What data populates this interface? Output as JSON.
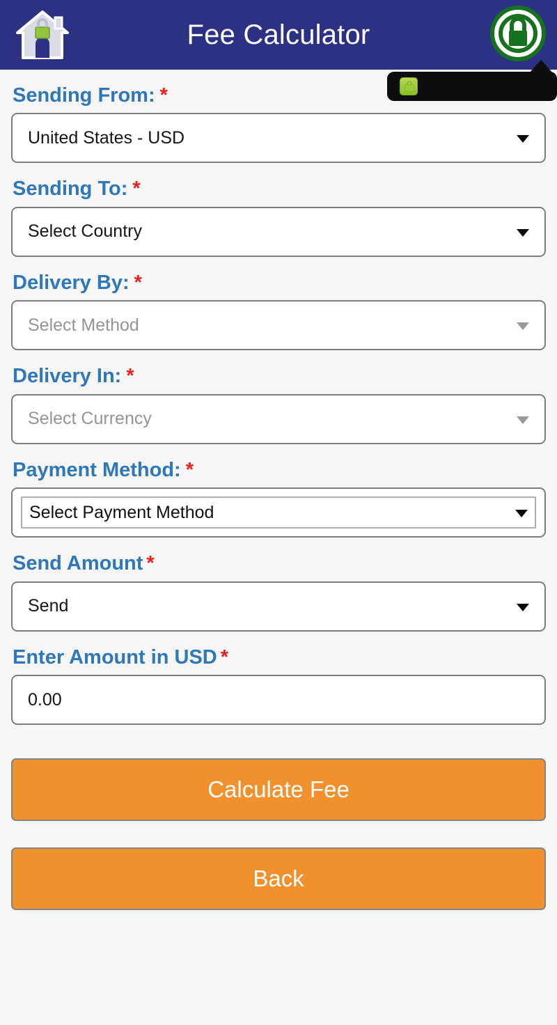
{
  "header": {
    "title": "Fee Calculator",
    "home_icon": "home-lock-icon",
    "secure_icon": "secure-lock-circle-icon",
    "background_color": "#2d3184"
  },
  "tooltip": {
    "icon": "padlock-icon",
    "text": "",
    "background_color": "#0d0d0d"
  },
  "form": {
    "required_marker": "*",
    "fields": [
      {
        "label": "Sending From:",
        "type": "select",
        "value": "United States - USD",
        "disabled": false
      },
      {
        "label": "Sending To:",
        "type": "select",
        "value": "Select Country",
        "disabled": false
      },
      {
        "label": "Delivery By:",
        "type": "select",
        "value": "Select Method",
        "disabled": true
      },
      {
        "label": "Delivery In:",
        "type": "select",
        "value": "Select Currency",
        "disabled": true
      },
      {
        "label": "Payment Method:",
        "type": "native-select",
        "value": "Select Payment Method",
        "disabled": false
      },
      {
        "label": "Send Amount",
        "type": "select",
        "value": "Send",
        "disabled": false
      },
      {
        "label": "Enter Amount in USD",
        "type": "text",
        "value": "0.00",
        "placeholder": "0.00",
        "disabled": false
      }
    ]
  },
  "actions": {
    "calculate_label": "Calculate Fee",
    "back_label": "Back",
    "button_color": "#f0912d",
    "label_color": "#2e77b8"
  }
}
